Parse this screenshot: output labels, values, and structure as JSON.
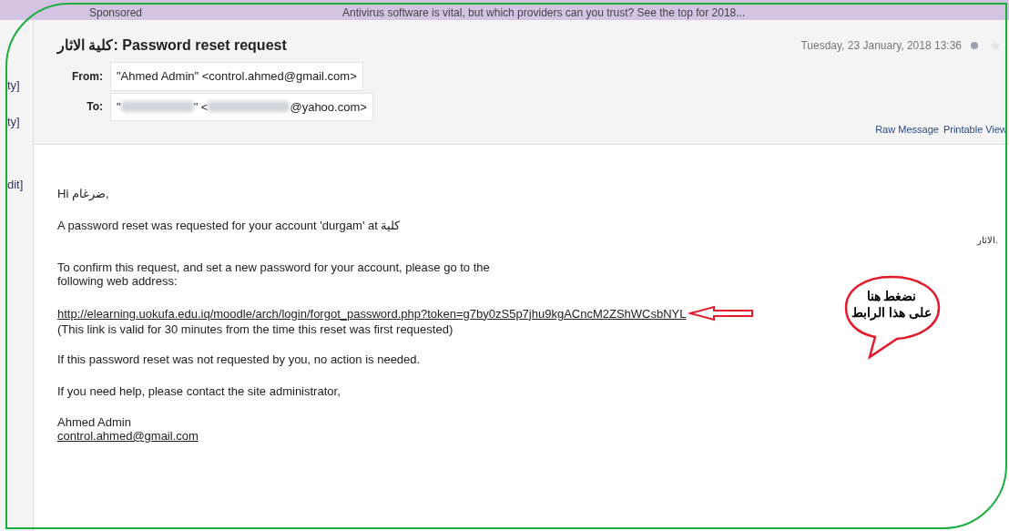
{
  "banner": {
    "label": "Sponsored",
    "text": "Antivirus software is vital, but which providers can you trust? See the top for 2018..."
  },
  "sidebar": {
    "items": [
      "ty]",
      "ty]",
      "dit]"
    ]
  },
  "message": {
    "subject": "كلية الاثار: Password reset request",
    "date": "Tuesday, 23 January, 2018 13:36",
    "starred": false,
    "from_label": "From:",
    "from": "\"Ahmed Admin\" <control.ahmed@gmail.com>",
    "to_label": "To:",
    "to": {
      "before": "\"",
      "middle": "\" <",
      "after": "@yahoo.com>"
    },
    "links": [
      "Raw Message",
      "Printable View"
    ]
  },
  "body": {
    "greeting": "Hi ضرغام,",
    "line_1": "A password reset was requested for your account 'durgam' at كلية",
    "line_1_overflow": "الاثار.",
    "confirm": "To confirm this request, and set a new password for your account, please go to the following web address:",
    "reset_link": "http://elearning.uokufa.edu.iq/moodle/arch/login/forgot_password.php?token=g7by0zS5p7jhu9kgACncM2ZShWCsbNYL",
    "validity": "(This link is valid for 30 minutes from the time this reset was first requested)",
    "no_action": "If this password reset was not requested by you, no action is needed.",
    "help": "If you need help, please contact the site administrator,",
    "signature_name": "Ahmed Admin",
    "signature_email": "control.ahmed@gmail.com"
  },
  "callout": {
    "lines": [
      "نضغط هنا",
      "على هذا الرابط"
    ]
  }
}
